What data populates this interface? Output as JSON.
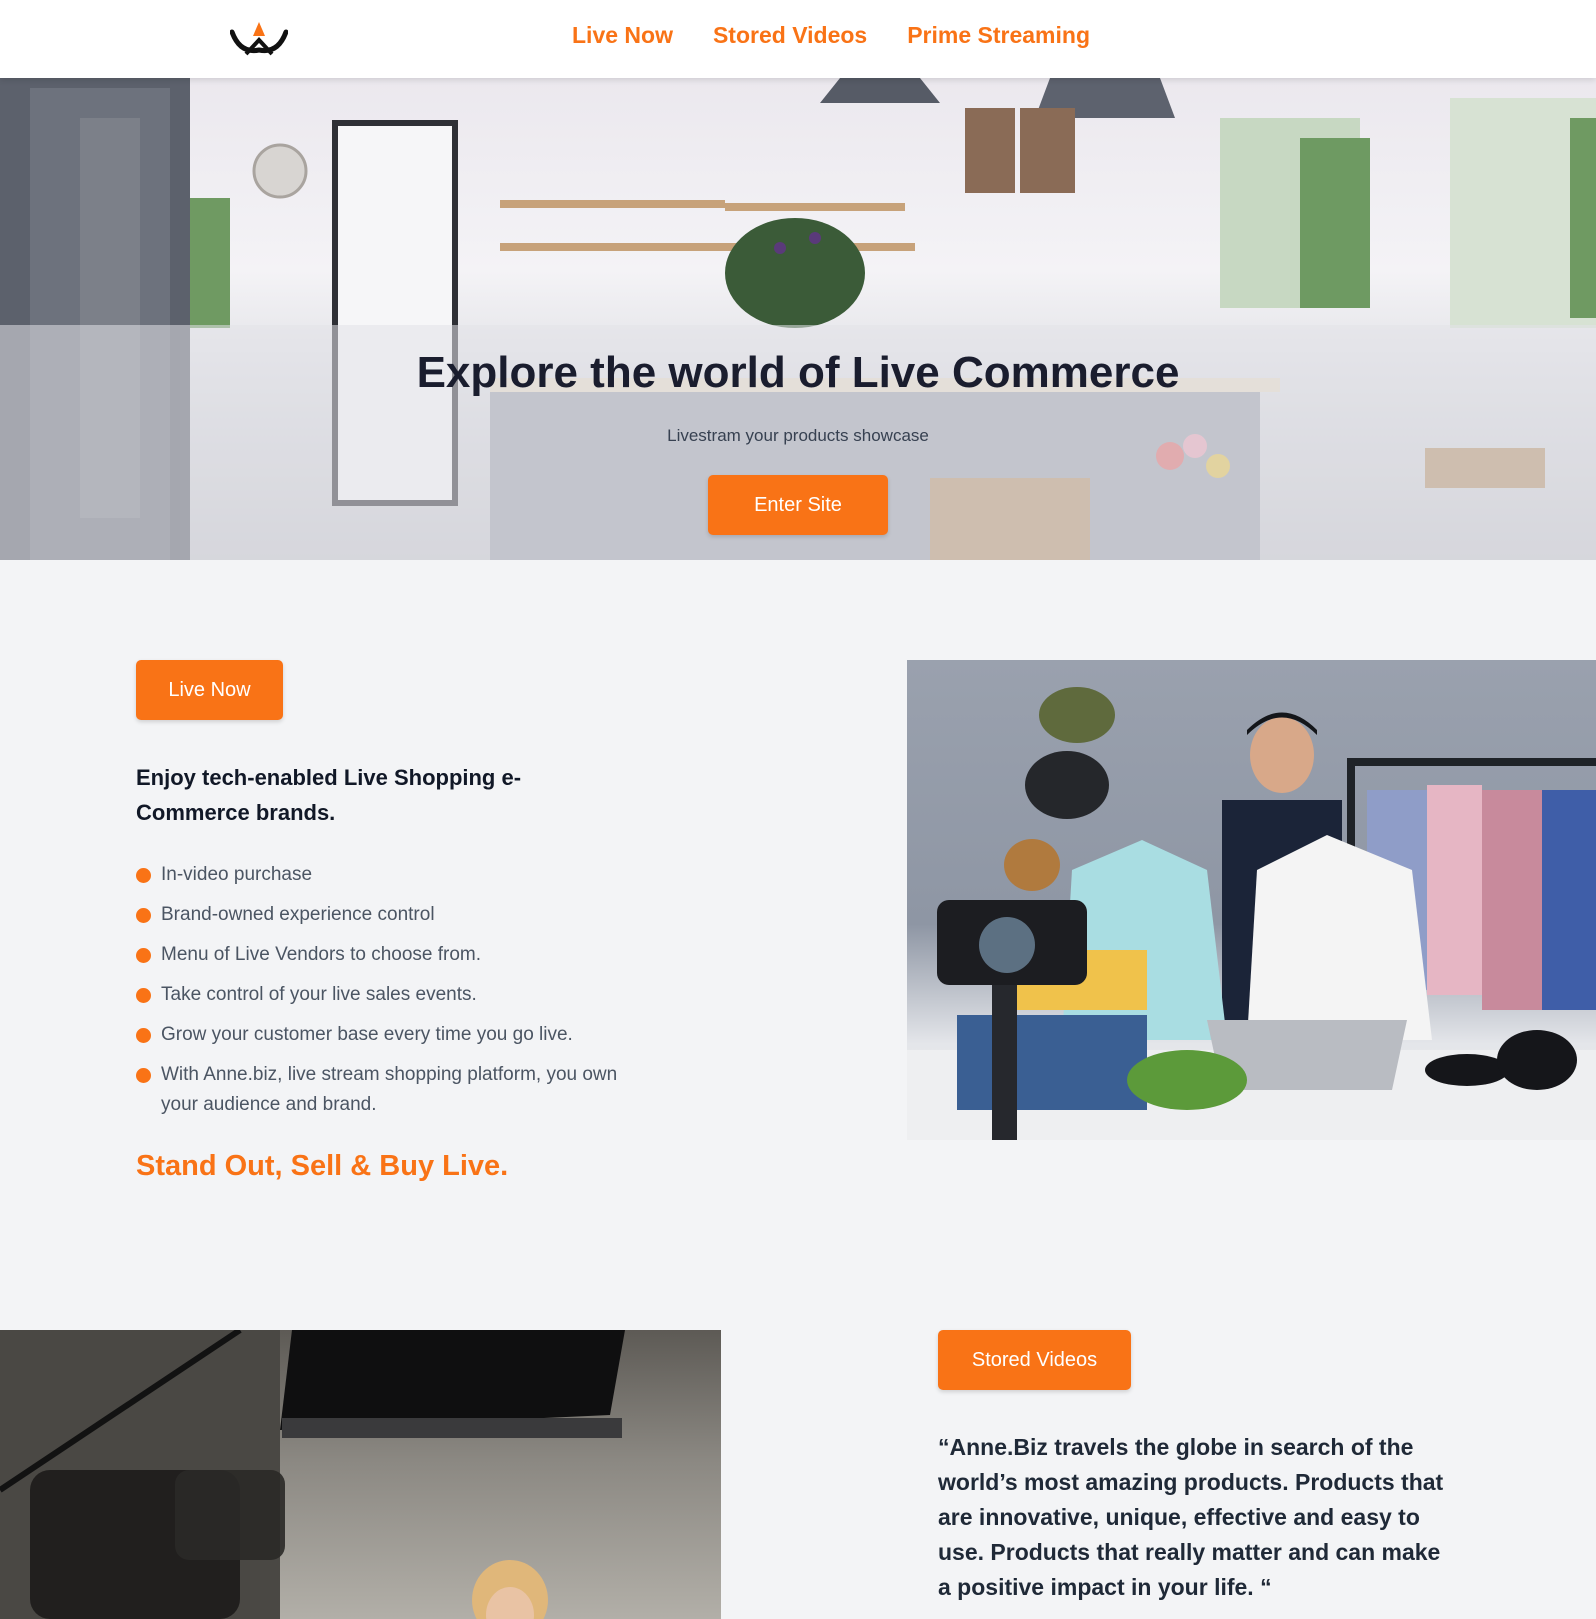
{
  "header": {
    "nav": [
      "Live Now",
      "Stored Videos",
      "Prime Streaming"
    ]
  },
  "hero": {
    "title": "Explore the world of Live Commerce",
    "subtitle": "Livestram your products showcase",
    "cta_label": "Enter Site"
  },
  "live_section": {
    "button_label": "Live Now",
    "heading": "Enjoy tech-enabled Live Shopping e-Commerce brands.",
    "features": [
      "In-video purchase",
      "Brand-owned experience control",
      "Menu of Live Vendors to choose from.",
      "Take control of your live sales events.",
      "Grow your customer base every time you go live.",
      "With Anne.biz, live stream shopping platform, you own your audience and brand."
    ],
    "tagline": "Stand Out, Sell & Buy Live."
  },
  "stored_section": {
    "button_label": "Stored Videos",
    "quote": "“Anne.Biz travels the globe in search of the world’s most amazing products. Products that are innovative, unique, effective and easy to use. Products that really matter and can make a positive impact in your life. “"
  },
  "colors": {
    "accent": "#f97316",
    "heading": "#1a1d2e",
    "page_bg": "#f3f4f6"
  },
  "icons": {
    "logo": "crown-logo-icon",
    "bullet": "orange-dot-icon"
  }
}
